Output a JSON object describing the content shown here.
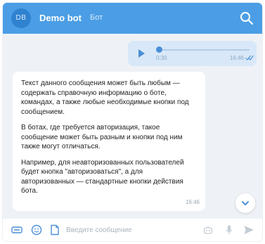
{
  "header": {
    "avatar_initials": "DB",
    "title": "Demo bot",
    "subtitle": "Бот"
  },
  "voice_message": {
    "duration": "0:30",
    "time": "16:46",
    "progress": 0.0
  },
  "message": {
    "paragraphs": [
      "Текст данного сообщения может быть любым — содержать справочную информацию о боте, командах, а также любые необходимые кнопки под сообщением.",
      "В ботах, где требуется авторизация, такое сообщение может быть разным и кнопки под ним также могут отличаться.",
      "Например, для неавторизованных пользователей будет кнопка \"авторизоваться\", а для авторизованных — стандартные кнопки действия бота."
    ],
    "time": "16:46"
  },
  "composer": {
    "placeholder": "Введите сообщение"
  },
  "colors": {
    "header_bg": "#4b9ee5",
    "accent": "#4b8fd6",
    "chat_bg": "#eef2f6",
    "outgoing_bubble": "#d8e8f8"
  }
}
